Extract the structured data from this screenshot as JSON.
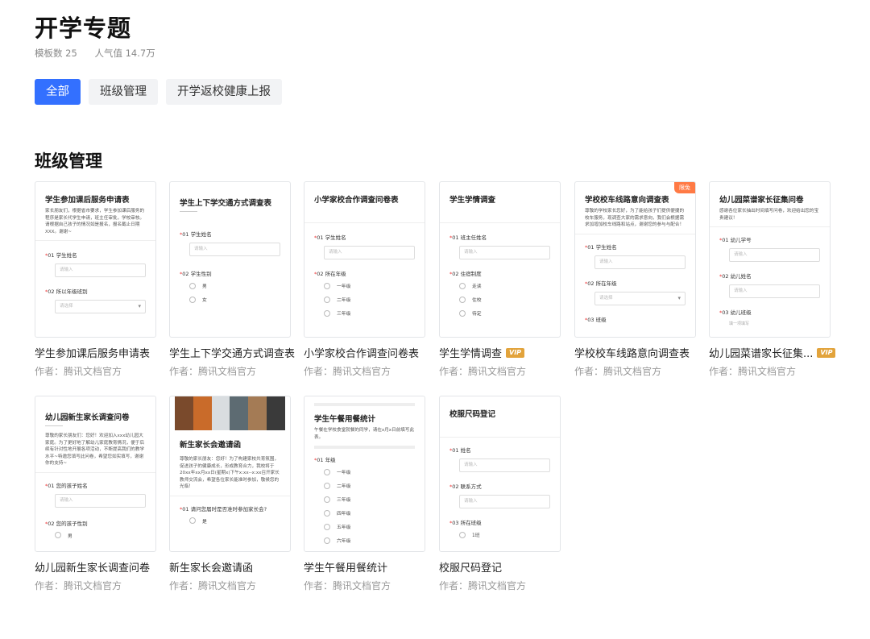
{
  "header": {
    "title": "开学专题",
    "template_count": "模板数 25",
    "popularity": "人气值 14.7万"
  },
  "tabs": [
    {
      "label": "全部",
      "active": true
    },
    {
      "label": "班级管理",
      "active": false
    },
    {
      "label": "开学返校健康上报",
      "active": false
    }
  ],
  "section": {
    "title": "班级管理"
  },
  "colors": {
    "accent": "#3370ff",
    "vip": "#e2a33b",
    "free_tag": "#ff7a45",
    "required_star": "#e33333"
  },
  "cards": [
    {
      "name": "学生参加课后服务申请表",
      "author": "作者：腾讯文档官方",
      "preview": {
        "title": "学生参加课后服务申请表",
        "desc": "家长朋友们，根据省市要求，学生参加课后服务的程序是家长代学生申请，班主任审批，学校审核。请根据自己孩子的情况如是报名，报名截止日期XXX。谢谢~",
        "q1": "01 学生姓名",
        "q1_placeholder": "请输入",
        "q2": "02 所以年级班别",
        "q2_placeholder": "请选择"
      }
    },
    {
      "name": "学生上下学交通方式调查表",
      "author": "作者：腾讯文档官方",
      "preview": {
        "title": "学生上下学交通方式调查表",
        "q1": "01 学生姓名",
        "q1_placeholder": "请输入",
        "q2": "02 学生性别",
        "opt1": "男",
        "opt2": "女"
      }
    },
    {
      "name": "小学家校合作调查问卷表",
      "author": "作者：腾讯文档官方",
      "preview": {
        "title": "小学家校合作调查问卷表",
        "q1": "01 学生姓名",
        "q1_placeholder": "请输入",
        "q2": "02 所在年级",
        "opt1": "一年级",
        "opt2": "二年级",
        "opt3": "三年级"
      }
    },
    {
      "name": "学生学情调查",
      "author": "作者：腾讯文档官方",
      "vip": "VIP",
      "preview": {
        "title": "学生学情调查",
        "q1": "01 班主任姓名",
        "q1_placeholder": "请输入",
        "q2": "02 住宿制度",
        "opt1": "走读",
        "opt2": "住校",
        "opt3": "待定"
      }
    },
    {
      "name": "学校校车线路意向调查表",
      "author": "作者：腾讯文档官方",
      "free_tag": "限免",
      "preview": {
        "title": "学校校车线路意向调查表",
        "desc": "尊敬的学校家长您好，为了能给孩子们提供便捷的校车服务，现调查大家的需求意向，我们会根据需求加增加校车线路和站点，谢谢您的参与与配合！",
        "q1": "01 学生姓名",
        "q1_placeholder": "请输入",
        "q2": "02 所在年级",
        "q2_placeholder": "请选择",
        "q3": "03 班级"
      }
    },
    {
      "name": "幼儿园菜谱家长征集...",
      "author": "作者：腾讯文档官方",
      "vip": "VIP",
      "preview": {
        "title": "幼儿园菜谱家长征集问卷",
        "desc": "感谢各位家长抽出时间填写问卷，欢迎给出您的宝贵建议！",
        "q1": "01 幼儿学号",
        "q1_placeholder": "请输入",
        "q2": "02 幼儿姓名",
        "q2_placeholder": "请输入",
        "q3": "03 幼儿班级",
        "q3_hint": "填一项填写"
      }
    },
    {
      "name": "幼儿园新生家长调查问卷",
      "author": "作者：腾讯文档官方",
      "preview": {
        "title": "幼儿园新生家长调查问卷",
        "desc": "尊敬的家长朋友们：您好！欢迎加入xxx幼儿园大家庭。为了更好地了解幼儿家庭教育情况，便于后续有针对性地开展各项活动，不断提高我们的教学水平~特邀您填写此问卷，希望您如实填写，谢谢你的支持~",
        "q1": "01 您的孩子姓名",
        "q1_placeholder": "请输入",
        "q2": "02 您的孩子性别",
        "opt1": "男"
      }
    },
    {
      "name": "新生家长会邀请函",
      "author": "作者：腾讯文档官方",
      "preview": {
        "title": "新生家长会邀请函",
        "desc": "尊敬的家长朋友：您好！为了构建家校共育氛围，促进孩子的健康成长，形成教育合力，我校将于20xx年xx月xx日(星期x)下午x:xx--x:xx召开家长教师交流会，希望各位家长能准时参加，敬候您的光临！",
        "q1": "01 请问您届时是否准时参加家长会?",
        "opt1": "是"
      }
    },
    {
      "name": "学生午餐用餐统计",
      "author": "作者：腾讯文档官方",
      "preview": {
        "title": "学生午餐用餐统计",
        "desc": "午餐在学校食堂就餐的同学，请在x月x日前填写此表。",
        "q1": "01 年级",
        "opts": [
          "一年级",
          "二年级",
          "三年级",
          "四年级",
          "五年级",
          "六年级"
        ]
      }
    },
    {
      "name": "校服尺码登记",
      "author": "作者：腾讯文档官方",
      "preview": {
        "title": "校服尺码登记",
        "q1": "01 姓名",
        "q1_placeholder": "请输入",
        "q2": "02 联系方式",
        "q2_placeholder": "请输入",
        "q3": "03 所在班级",
        "opt1": "1班"
      }
    }
  ]
}
